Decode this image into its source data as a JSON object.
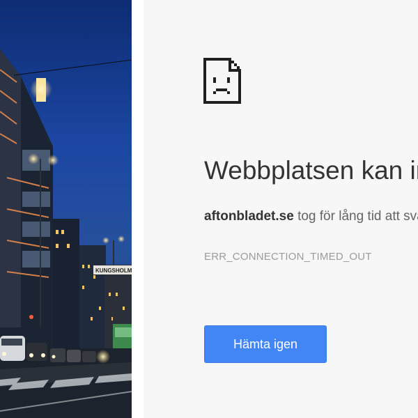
{
  "photo": {
    "street_sign": "KUNGSHOLM"
  },
  "error_page": {
    "icon": "sad-document-icon",
    "title": "Webbplatsen kan inte nås",
    "domain": "aftonbladet.se",
    "description_suffix": " tog för lång tid att svara.",
    "error_code": "ERR_CONNECTION_TIMED_OUT",
    "reload_label": "Hämta igen"
  },
  "colors": {
    "panel_background": "#f7f7f7",
    "button_blue": "#4285f4",
    "title_text": "#333333"
  }
}
